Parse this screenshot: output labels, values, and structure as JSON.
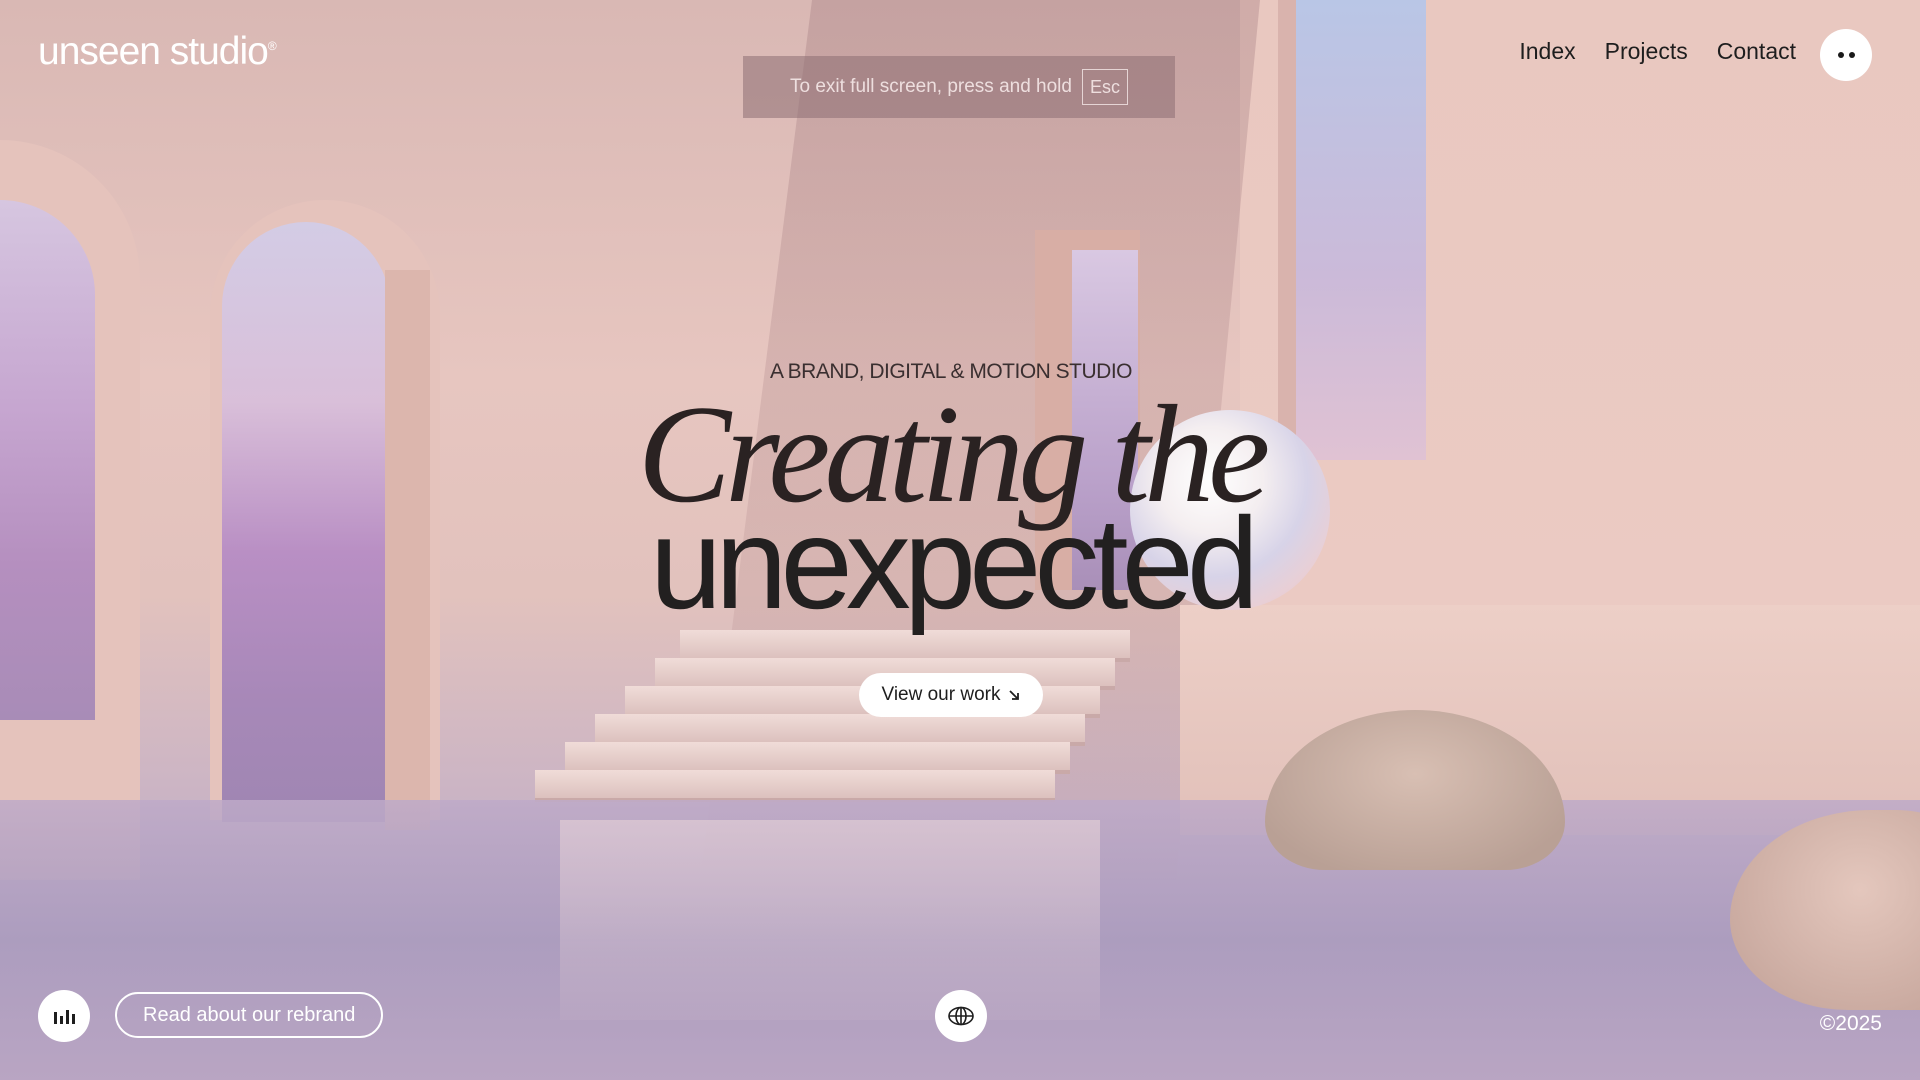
{
  "header": {
    "logo_text": "unseen studio",
    "logo_mark": "®",
    "nav": [
      "Index",
      "Projects",
      "Contact"
    ],
    "menu_icon": "more-dots-icon"
  },
  "fullscreen_notice": {
    "text": "To exit full screen, press and hold",
    "key": "Esc"
  },
  "hero": {
    "eyebrow": "A BRAND, DIGITAL & MOTION STUDIO",
    "headline_line1": "Creating the",
    "headline_line2": "unexpected",
    "cta_label": "View our work",
    "cta_icon": "arrow-down-right-icon"
  },
  "footer": {
    "sound_icon": "sound-bars-icon",
    "rebrand_label": "Read about our rebrand",
    "language_icon": "globe-icon",
    "copyright": "©2025"
  },
  "colors": {
    "background": "#e2c2bd",
    "text_dark": "#222020",
    "text_light": "#ffffff"
  }
}
